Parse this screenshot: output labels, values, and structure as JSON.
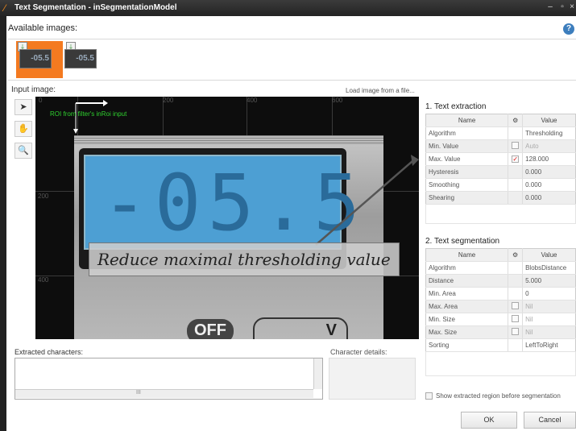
{
  "window": {
    "title": "Text Segmentation - inSegmentationModel",
    "controls": [
      "–",
      "▫",
      "×"
    ]
  },
  "available_images": {
    "label": "Available images:",
    "thumbnails": [
      {
        "caption": "-05.5",
        "selected": true
      },
      {
        "caption": "-05.5",
        "selected": false
      }
    ]
  },
  "input_image": {
    "label": "Input image:",
    "load_link": "Load image from a file...",
    "roi_label": "ROI from filter's inRoi input",
    "ruler_x": [
      "0",
      "200",
      "400",
      "600"
    ],
    "ruler_y": [
      "200",
      "400"
    ],
    "display_value": "-05.5",
    "off_label": "OFF",
    "bottom_glyph": "V",
    "annotation": "Reduce maximal thresholding value"
  },
  "tools": [
    {
      "icon": "pointer-icon",
      "glyph": "➤"
    },
    {
      "icon": "hand-icon",
      "glyph": "✋"
    },
    {
      "icon": "zoom-icon",
      "glyph": "🔍"
    }
  ],
  "text_extraction": {
    "title": "1. Text extraction",
    "headers": [
      "Name",
      "⚙",
      "Value"
    ],
    "rows": [
      {
        "name": "Algorithm",
        "check": "",
        "value": "Thresholding",
        "disabled": false
      },
      {
        "name": "Min. Value",
        "check": "box",
        "value": "Auto",
        "disabled": true
      },
      {
        "name": "Max. Value",
        "check": "checked",
        "value": "128.000",
        "disabled": false
      },
      {
        "name": "Hysteresis",
        "check": "",
        "value": "0.000",
        "disabled": false
      },
      {
        "name": "Smoothing",
        "check": "",
        "value": "0.000",
        "disabled": false
      },
      {
        "name": "Shearing",
        "check": "",
        "value": "0.000",
        "disabled": false
      }
    ]
  },
  "text_segmentation": {
    "title": "2. Text segmentation",
    "headers": [
      "Name",
      "⚙",
      "Value"
    ],
    "rows": [
      {
        "name": "Algorithm",
        "check": "",
        "value": "BlobsDistance",
        "disabled": false
      },
      {
        "name": "Distance",
        "check": "",
        "value": "5.000",
        "disabled": false
      },
      {
        "name": "Min. Area",
        "check": "",
        "value": "0",
        "disabled": false
      },
      {
        "name": "Max. Area",
        "check": "box",
        "value": "Nil",
        "disabled": true
      },
      {
        "name": "Min. Size",
        "check": "box",
        "value": "Nil",
        "disabled": true
      },
      {
        "name": "Max. Size",
        "check": "box",
        "value": "Nil",
        "disabled": true
      },
      {
        "name": "Sorting",
        "check": "",
        "value": "LeftToRight",
        "disabled": false
      }
    ]
  },
  "extracted": {
    "label": "Extracted characters:",
    "scroll_mark": "III"
  },
  "character_details": {
    "label": "Character details:"
  },
  "show_region": {
    "label": "Show extracted region before segmentation",
    "checked": false
  },
  "buttons": {
    "ok": "OK",
    "cancel": "Cancel"
  },
  "colors": {
    "accent": "#f47a20",
    "lcd": "#4d9fd3",
    "roi_text": "#2fd12f"
  }
}
